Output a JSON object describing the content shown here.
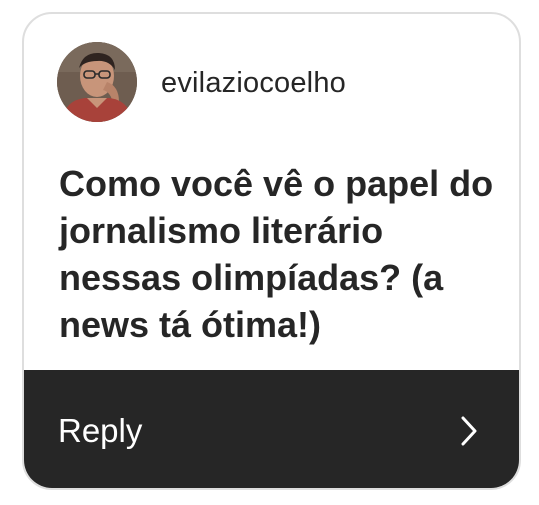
{
  "post": {
    "username": "evilaziocoelho",
    "question": "Como você vê o papel do jornalismo literário nessas olimpíadas? (a news tá ótima!)"
  },
  "reply": {
    "label": "Reply",
    "icon": "chevron-right-icon"
  },
  "colors": {
    "text": "#262626",
    "reply_bar": "#262626",
    "reply_text": "#ffffff",
    "card_border": "#dedede"
  }
}
